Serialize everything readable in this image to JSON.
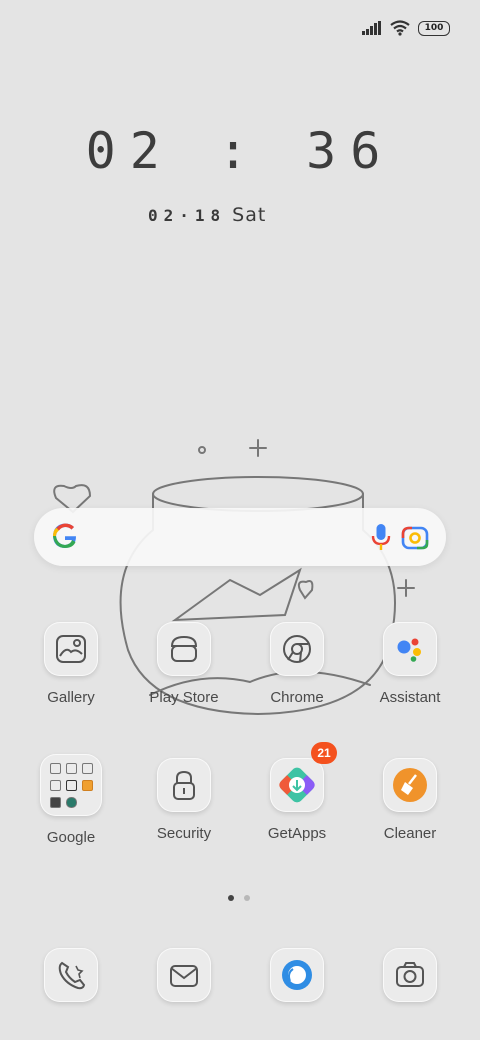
{
  "status": {
    "battery": "100",
    "icons": [
      "signal-icon",
      "wifi-icon",
      "battery-icon"
    ]
  },
  "clock": {
    "time": "02:36",
    "date": "02·18",
    "weekday": "Sat"
  },
  "search": {
    "icons": [
      "google-logo-icon",
      "microphone-icon",
      "camera-lens-icon"
    ]
  },
  "apps": {
    "row1": [
      {
        "label": "Gallery",
        "icon": "gallery-icon"
      },
      {
        "label": "Play Store",
        "icon": "play-store-icon"
      },
      {
        "label": "Chrome",
        "icon": "chrome-icon"
      },
      {
        "label": "Assistant",
        "icon": "assistant-icon"
      }
    ],
    "row2": [
      {
        "label": "Google",
        "icon": "google-folder-icon"
      },
      {
        "label": "Security",
        "icon": "security-lock-icon"
      },
      {
        "label": "GetApps",
        "icon": "getapps-icon",
        "badge": "21"
      },
      {
        "label": "Cleaner",
        "icon": "cleaner-broom-icon"
      }
    ]
  },
  "dock": [
    {
      "icon": "phone-icon"
    },
    {
      "icon": "messages-icon"
    },
    {
      "icon": "browser-icon"
    },
    {
      "icon": "camera-icon"
    }
  ],
  "pager": {
    "pages": 2,
    "current": 1
  },
  "colors": {
    "background": "#e4e4e4",
    "badge": "#f4511e",
    "cleaner": "#f0932b"
  }
}
